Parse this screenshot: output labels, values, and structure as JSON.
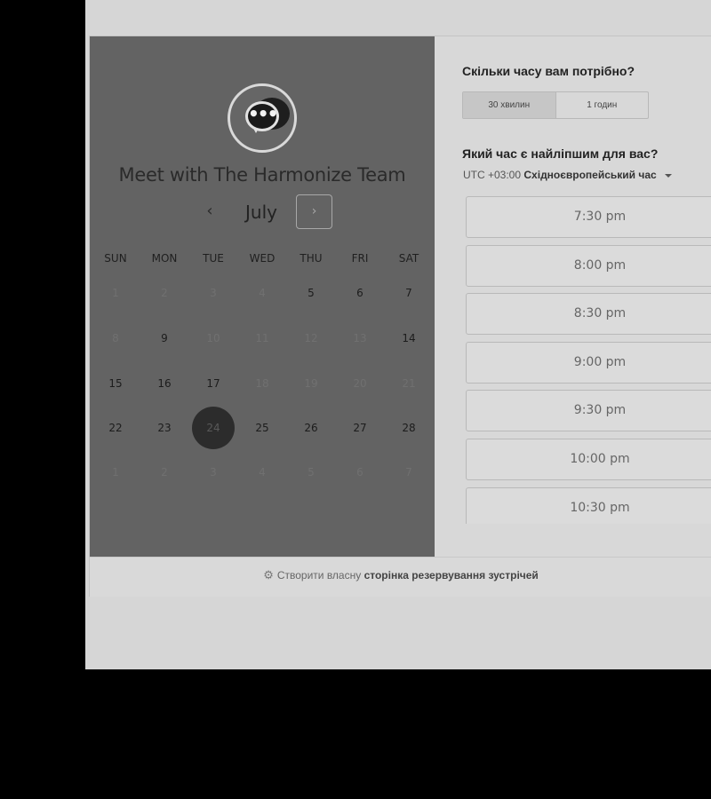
{
  "meeting": {
    "title": "Meet with The Harmonize Team",
    "logo_icon": "chat-bubble-icon",
    "logo_glyph": "•••"
  },
  "calendar": {
    "month": "July",
    "prev_glyph": "‹",
    "next_glyph": "›",
    "weekdays": [
      "SUN",
      "MON",
      "TUE",
      "WED",
      "THU",
      "FRI",
      "SAT"
    ],
    "weeks": [
      [
        {
          "d": "1",
          "s": "dis"
        },
        {
          "d": "2",
          "s": "dis"
        },
        {
          "d": "3",
          "s": "dis"
        },
        {
          "d": "4",
          "s": "dis"
        },
        {
          "d": "5",
          "s": "avail"
        },
        {
          "d": "6",
          "s": "avail"
        },
        {
          "d": "7",
          "s": "avail"
        }
      ],
      [
        {
          "d": "8",
          "s": "dis"
        },
        {
          "d": "9",
          "s": "avail"
        },
        {
          "d": "10",
          "s": "dis"
        },
        {
          "d": "11",
          "s": "dis"
        },
        {
          "d": "12",
          "s": "dis"
        },
        {
          "d": "13",
          "s": "dis"
        },
        {
          "d": "14",
          "s": "avail"
        }
      ],
      [
        {
          "d": "15",
          "s": "avail"
        },
        {
          "d": "16",
          "s": "avail"
        },
        {
          "d": "17",
          "s": "avail"
        },
        {
          "d": "18",
          "s": "dis"
        },
        {
          "d": "19",
          "s": "dis"
        },
        {
          "d": "20",
          "s": "dis"
        },
        {
          "d": "21",
          "s": "dis"
        }
      ],
      [
        {
          "d": "22",
          "s": "avail"
        },
        {
          "d": "23",
          "s": "avail"
        },
        {
          "d": "24",
          "s": "sel"
        },
        {
          "d": "25",
          "s": "avail"
        },
        {
          "d": "26",
          "s": "avail"
        },
        {
          "d": "27",
          "s": "avail"
        },
        {
          "d": "28",
          "s": "avail"
        }
      ],
      [
        {
          "d": "1",
          "s": "dis"
        },
        {
          "d": "2",
          "s": "dis"
        },
        {
          "d": "3",
          "s": "dis"
        },
        {
          "d": "4",
          "s": "dis"
        },
        {
          "d": "5",
          "s": "dis"
        },
        {
          "d": "6",
          "s": "dis"
        },
        {
          "d": "7",
          "s": "dis"
        }
      ]
    ],
    "selected_day": "24"
  },
  "booking": {
    "duration_question": "Скільки часу вам потрібно?",
    "durations": [
      "30 хвилин",
      "1 годин"
    ],
    "active_duration": "30 хвилин",
    "time_question": "Який час є найліпшим для вас?",
    "timezone_offset": "UTC +03:00",
    "timezone_name": "Східноєвропейський час",
    "slots": [
      "7:30 pm",
      "8:00 pm",
      "8:30 pm",
      "9:00 pm",
      "9:30 pm",
      "10:00 pm",
      "10:30 pm"
    ]
  },
  "footer": {
    "icon": "sprocket-icon",
    "icon_glyph": "⚙",
    "prefix": "Створити власну",
    "bold": "сторінка резервування зустрічей"
  },
  "colors": {
    "left_panel": "#636363",
    "right_panel": "#d8d8d8",
    "selected_day": "#2c2c2c",
    "screen_background": "#000000"
  }
}
